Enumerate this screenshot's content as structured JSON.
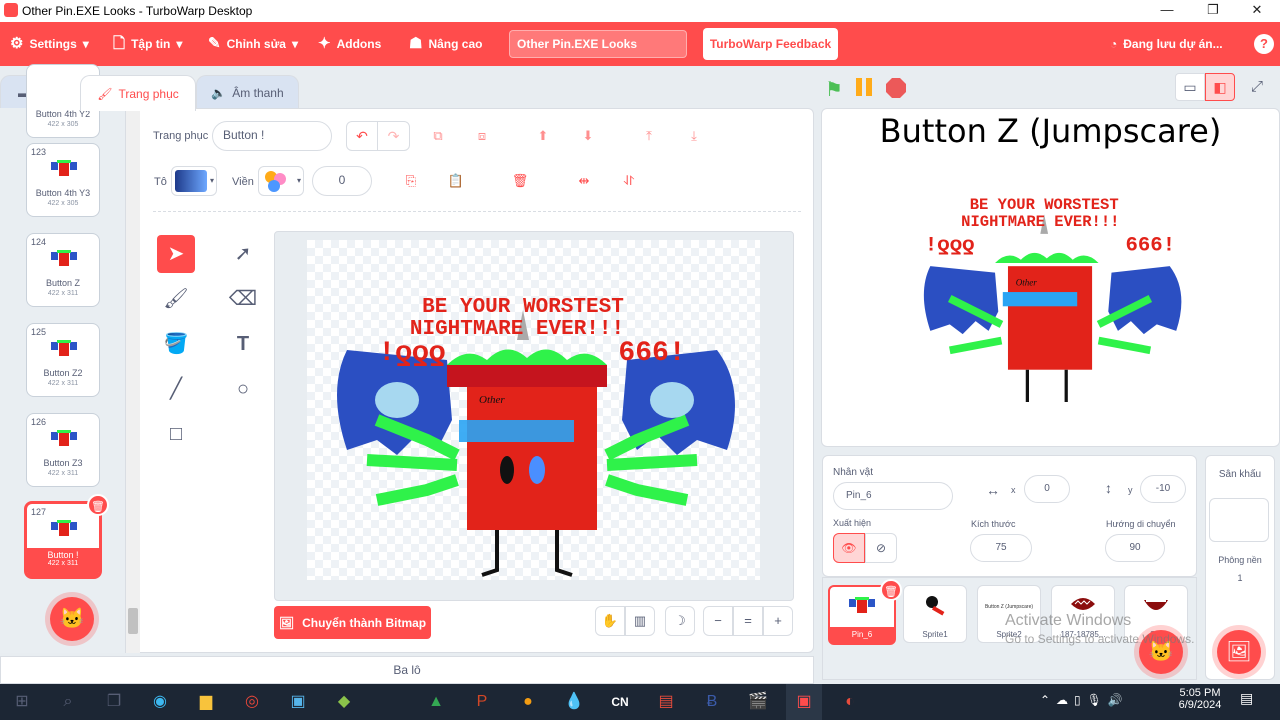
{
  "window": {
    "title": "Other Pin.EXE Looks - TurboWarp Desktop",
    "minimize": "—",
    "maximize": "❐",
    "close": "✕"
  },
  "menubar": {
    "settings": "Settings",
    "file": "Tập tin",
    "edit": "Chỉnh sửa",
    "addons": "Addons",
    "advanced": "Nâng cao",
    "project_title": "Other Pin.EXE Looks",
    "feedback": "TurboWarp Feedback",
    "saving": "Đang lưu dự án..."
  },
  "tabs": {
    "code": "code",
    "costumes": "Trang phục",
    "sounds": "Âm thanh"
  },
  "costumes": [
    {
      "num": "",
      "name": "Button 4th Y2",
      "size": "422 x 305"
    },
    {
      "num": "123",
      "name": "Button 4th Y3",
      "size": "422 x 305"
    },
    {
      "num": "124",
      "name": "Button Z",
      "size": "422 x 311"
    },
    {
      "num": "125",
      "name": "Button Z2",
      "size": "422 x 311"
    },
    {
      "num": "126",
      "name": "Button Z3",
      "size": "422 x 311"
    },
    {
      "num": "127",
      "name": "Button !",
      "size": "422 x 311"
    }
  ],
  "paint": {
    "costume_label": "Trang phục",
    "costume_name": "Button !",
    "fill_label": "Tô",
    "outline_label": "Viền",
    "outline_width": "0",
    "convert_button": "Chuyển thành Bitmap",
    "art_text1": "BE YOUR WORSTEST",
    "art_text2": "NIGHTMARE EVER!!!",
    "art_left": "!ƍƍƍ",
    "art_right": "666!",
    "art_tag": "Other"
  },
  "backpack": "Ba lô",
  "stage": {
    "title": "Button Z (Jumpscare)",
    "art_text1": "BE YOUR WORSTEST",
    "art_text2": "NIGHTMARE EVER!!!",
    "art_left": "!ƍƍƍ",
    "art_right": "666!",
    "art_tag": "Other"
  },
  "sprite_info": {
    "sprite_label": "Nhân vật",
    "sprite_name": "Pin_6",
    "x_label": "x",
    "x": "0",
    "y_label": "y",
    "y": "-10",
    "show_label": "Xuất hiện",
    "size_label": "Kích thước",
    "size": "75",
    "direction_label": "Hướng di chuyển",
    "direction": "90"
  },
  "sprites": [
    {
      "name": "Pin_6"
    },
    {
      "name": "Sprite1"
    },
    {
      "name": "Sprite2"
    },
    {
      "name": "187-18785..."
    },
    {
      "name": "S..."
    }
  ],
  "sprite2_thumb_text": "Button Z (Jumpscare)",
  "stage_panel": {
    "label": "Sân khấu",
    "backdrops_label": "Phông nền",
    "backdrops_count": "1"
  },
  "watermark": {
    "line1": "Activate Windows",
    "line2": "Go to Settings to activate Windows."
  },
  "taskbar": {
    "time": "5:05 PM",
    "date": "6/9/2024"
  },
  "colors": {
    "accent": "#ff4c4c",
    "flag": "#4cbf56",
    "pause": "#ffab19"
  }
}
